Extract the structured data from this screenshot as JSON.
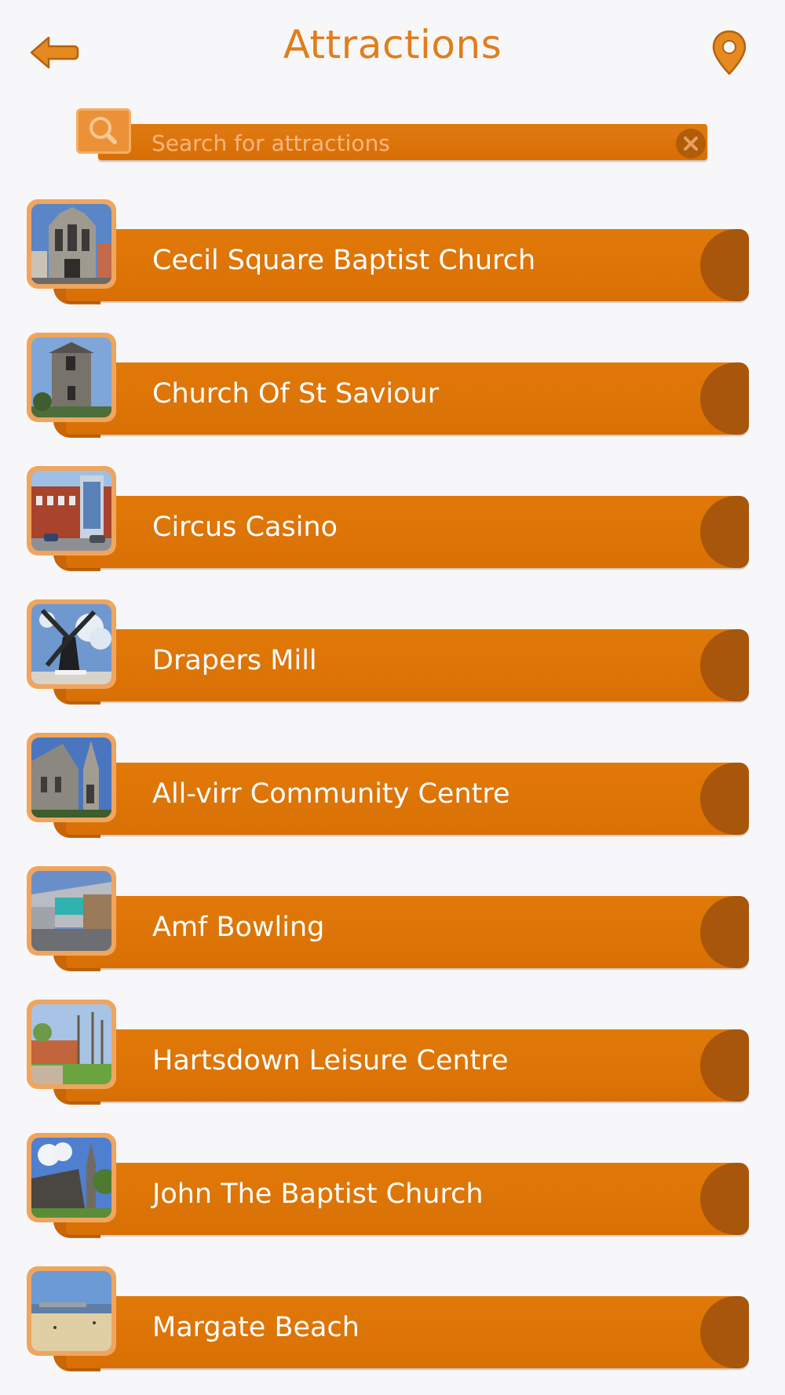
{
  "header": {
    "title": "Attractions",
    "back_icon": "back-arrow-icon",
    "map_icon": "map-pin-icon"
  },
  "search": {
    "placeholder": "Search for attractions",
    "value": "",
    "search_icon": "magnifier-icon",
    "clear_icon": "clear-x-icon"
  },
  "colors": {
    "accent": "#e07e1c",
    "bar": "#db7107",
    "bar_end": "#a7560b",
    "thumb_frame": "#f0a55e",
    "background": "#f7f7f9"
  },
  "attractions": [
    {
      "label": "Cecil Square Baptist Church",
      "image": "gothic-church-photo"
    },
    {
      "label": "Church Of St Saviour",
      "image": "stone-tower-photo"
    },
    {
      "label": "Circus Casino",
      "image": "brick-casino-building-photo"
    },
    {
      "label": "Drapers Mill",
      "image": "windmill-photo"
    },
    {
      "label": "All-virr Community Centre",
      "image": "church-spire-photo"
    },
    {
      "label": "Amf Bowling",
      "image": "bowling-building-photo"
    },
    {
      "label": "Hartsdown Leisure Centre",
      "image": "leisure-centre-trees-photo"
    },
    {
      "label": "John The Baptist Church",
      "image": "church-with-tree-photo"
    },
    {
      "label": "Margate Beach",
      "image": "sandy-beach-photo"
    }
  ]
}
